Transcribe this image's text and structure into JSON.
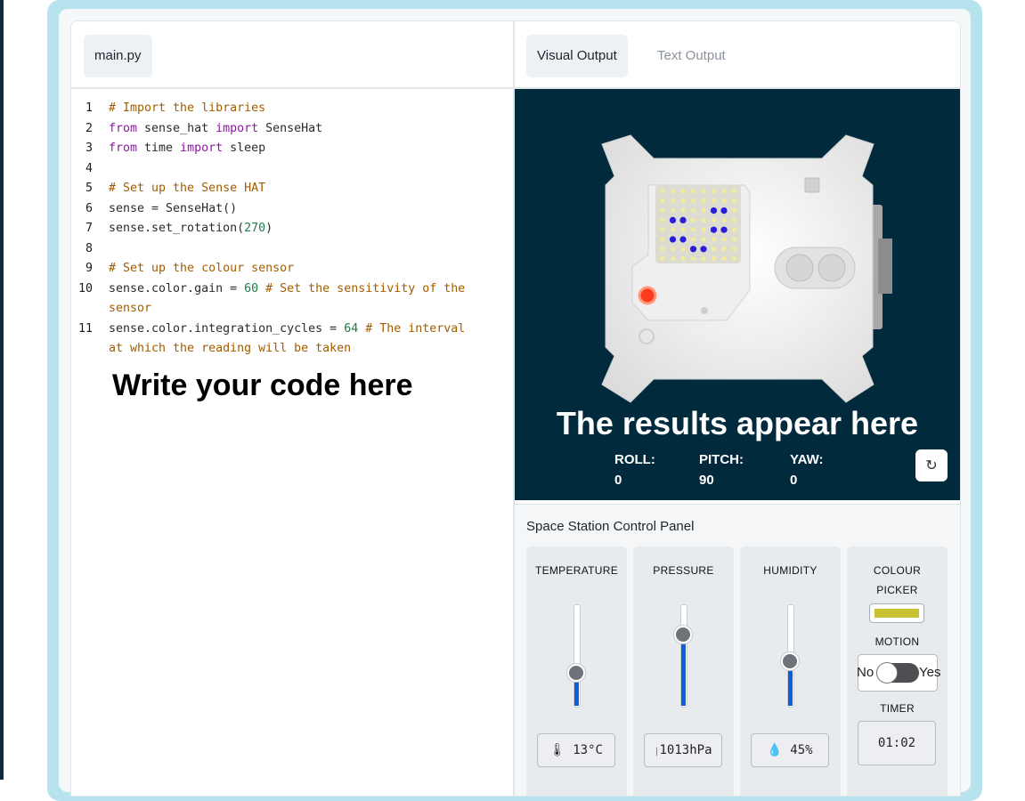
{
  "editor": {
    "tab_label": "main.py",
    "lines": [
      {
        "n": "1"
      },
      {
        "n": "2"
      },
      {
        "n": "3"
      },
      {
        "n": "4"
      },
      {
        "n": "5"
      },
      {
        "n": "6"
      },
      {
        "n": "7"
      },
      {
        "n": "8"
      },
      {
        "n": "9"
      },
      {
        "n": "10"
      },
      {
        "n": "11"
      }
    ],
    "code": {
      "l1": "# Import the libraries",
      "l2a": "from",
      "l2b": " sense_hat ",
      "l2c": "import",
      "l2d": " SenseHat",
      "l3a": "from",
      "l3b": " time ",
      "l3c": "import",
      "l3d": " sleep",
      "l5": "# Set up the Sense HAT",
      "l6": "sense = SenseHat()",
      "l7a": "sense.set_rotation(",
      "l7b": "270",
      "l7c": ")",
      "l9": "# Set up the colour sensor",
      "l10a": "sense.color.gain = ",
      "l10b": "60",
      "l10c": " # Set the sensitivity of the",
      "l10d": "sensor",
      "l11a": "sense.color.integration_cycles = ",
      "l11b": "64",
      "l11c": " # The interval",
      "l11d": "at which the reading will be taken"
    },
    "annotation": "Write your code here"
  },
  "output": {
    "tabs": {
      "visual": "Visual Output",
      "text": "Text Output"
    },
    "annotation": "The results appear here",
    "orientation": {
      "roll_label": "ROLL:",
      "roll_value": "0",
      "pitch_label": "PITCH:",
      "pitch_value": "90",
      "yaw_label": "YAW:",
      "yaw_value": "0"
    },
    "reset_icon": "refresh-icon"
  },
  "control_panel": {
    "title": "Space Station Control Panel",
    "temperature": {
      "label": "TEMPERATURE",
      "value": "13°C",
      "level": 0.33,
      "icon": "thermometer-icon"
    },
    "pressure": {
      "label": "PRESSURE",
      "value": "1013hPa",
      "level": 0.71,
      "icon": "gauge-icon"
    },
    "humidity": {
      "label": "HUMIDITY",
      "value": "45%",
      "level": 0.45,
      "icon": "droplet-icon"
    },
    "colour_picker": {
      "label_line1": "COLOUR",
      "label_line2": "PICKER",
      "color": "#c9c233"
    },
    "motion": {
      "label": "MOTION",
      "off": "No",
      "on": "Yes"
    },
    "timer": {
      "label": "TIMER",
      "value": "01:02"
    }
  },
  "colors": {
    "accent": "#0b5fd8",
    "stage_bg": "#022a3d",
    "frame": "#b7e3ee"
  }
}
